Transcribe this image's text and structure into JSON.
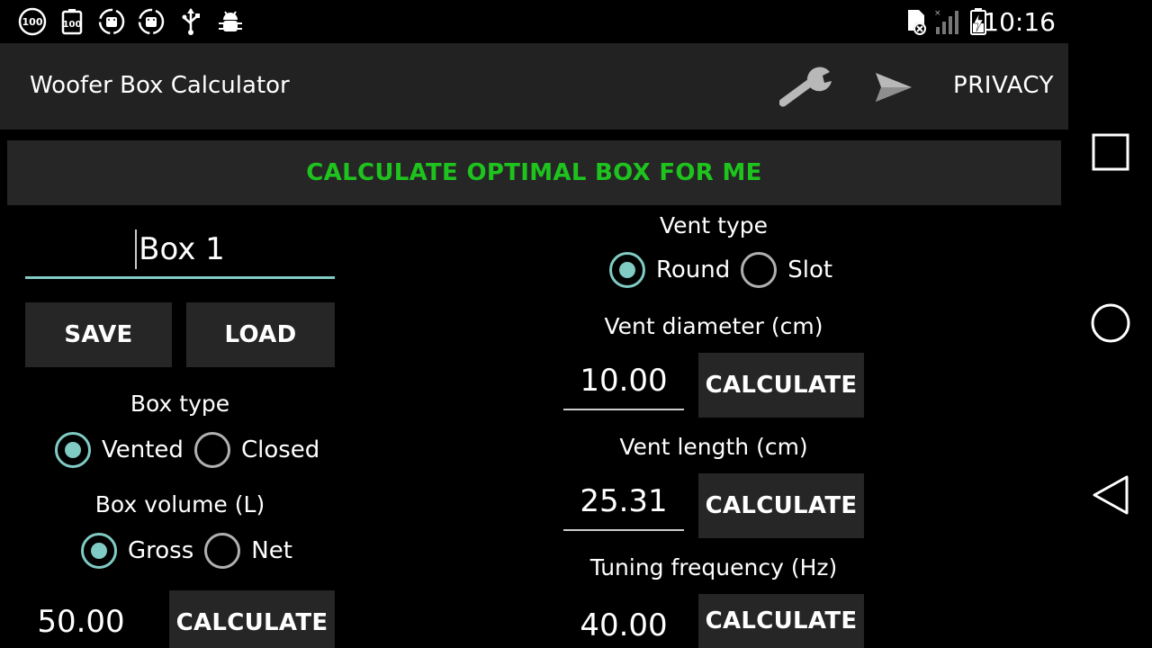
{
  "status_bar": {
    "time": "10:16",
    "left_icons": [
      "battery-100-circle-icon",
      "battery-100-icon",
      "android-sync-icon",
      "android-sync-icon",
      "usb-icon",
      "android-debug-icon"
    ],
    "right_icons": [
      "sd-card-icon",
      "signal-icon",
      "battery-charging-icon"
    ],
    "badge_100": "100"
  },
  "action_bar": {
    "title": "Woofer Box Calculator",
    "settings_icon": "wrench-icon",
    "share_icon": "send-icon",
    "privacy_label": "PRIVACY"
  },
  "optimal_button": {
    "label": "CALCULATE OPTIMAL BOX FOR ME"
  },
  "box": {
    "name": "Box 1",
    "save_label": "SAVE",
    "load_label": "LOAD",
    "box_type_label": "Box type",
    "box_type_options": [
      "Vented",
      "Closed"
    ],
    "box_type_selected": "Vented",
    "volume_label": "Box volume  (L)",
    "volume_options": [
      "Gross",
      "Net"
    ],
    "volume_selected": "Gross",
    "volume_value": "50.00",
    "calculate_label": "CALCULATE"
  },
  "vent": {
    "type_label": "Vent type",
    "type_options": [
      "Round",
      "Slot"
    ],
    "type_selected": "Round",
    "diameter_label": "Vent diameter  (cm)",
    "diameter_value": "10.00",
    "length_label": "Vent length  (cm)",
    "length_value": "25.31",
    "tuning_label": "Tuning frequency (Hz)",
    "tuning_value": "40.00",
    "calculate_label": "CALCULATE"
  },
  "colors": {
    "accent": "#80cbc4",
    "optimal_text": "#1ec31e",
    "button_bg": "#262626",
    "action_bar_bg": "#222222"
  }
}
